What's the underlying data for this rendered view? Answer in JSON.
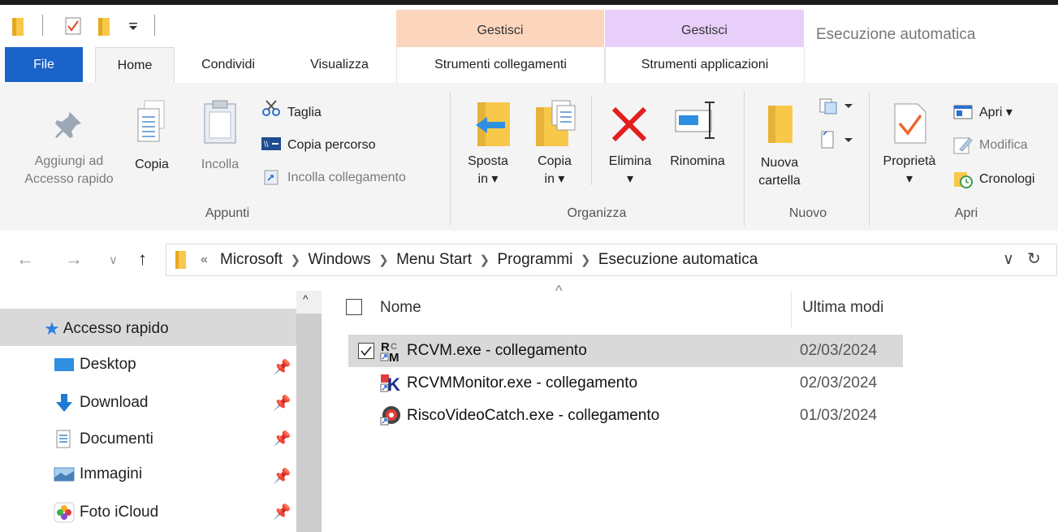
{
  "window": {
    "title": "Esecuzione automatica"
  },
  "context_groups": [
    {
      "header": "Gestisci",
      "tab": "Strumenti collegamenti",
      "color": "#fbd6bd"
    },
    {
      "header": "Gestisci",
      "tab": "Strumenti applicazioni",
      "color": "#e8cff9"
    }
  ],
  "tabs": [
    "File",
    "Home",
    "Condividi",
    "Visualizza"
  ],
  "ribbon": {
    "appunti": {
      "pin_line1": "Aggiungi ad",
      "pin_line2": "Accesso rapido",
      "copy": "Copia",
      "paste": "Incolla",
      "cut": "Taglia",
      "copy_path": "Copia percorso",
      "paste_link": "Incolla collegamento",
      "group": "Appunti"
    },
    "organizza": {
      "move_l1": "Sposta",
      "move_l2": "in ▾",
      "copyto_l1": "Copia",
      "copyto_l2": "in ▾",
      "delete": "Elimina",
      "delete_arrow": "▾",
      "rename": "Rinomina",
      "group": "Organizza"
    },
    "nuovo": {
      "folder_l1": "Nuova",
      "folder_l2": "cartella",
      "group": "Nuovo"
    },
    "apri": {
      "properties": "Proprietà",
      "properties_arrow": "▾",
      "open": "Apri ▾",
      "edit": "Modifica",
      "history": "Cronologi",
      "group": "Apri"
    }
  },
  "address": {
    "overflow": "«",
    "crumbs": [
      "Microsoft",
      "Windows",
      "Menu Start",
      "Programmi",
      "Esecuzione automatica"
    ]
  },
  "nav_pane": {
    "items": [
      {
        "label": "Accesso rapido",
        "icon": "star-icon"
      },
      {
        "label": "Desktop",
        "icon": "desktop-icon"
      },
      {
        "label": "Download",
        "icon": "download-icon"
      },
      {
        "label": "Documenti",
        "icon": "documents-icon"
      },
      {
        "label": "Immagini",
        "icon": "pictures-icon"
      },
      {
        "label": "Foto iCloud",
        "icon": "icloud-photos-icon"
      }
    ]
  },
  "file_list": {
    "columns": {
      "name": "Nome",
      "modified": "Ultima modi"
    },
    "files": [
      {
        "name": "RCVM.exe - collegamento",
        "date": "02/03/2024",
        "selected": true
      },
      {
        "name": "RCVMMonitor.exe - collegamento",
        "date": "02/03/2024",
        "selected": false
      },
      {
        "name": "RiscoVideoCatch.exe - collegamento",
        "date": "01/03/2024",
        "selected": false
      }
    ]
  },
  "colors": {
    "accent": "#1a63c9",
    "selection": "#d9d9d9",
    "ribbon_bg": "#f4f4f4"
  }
}
